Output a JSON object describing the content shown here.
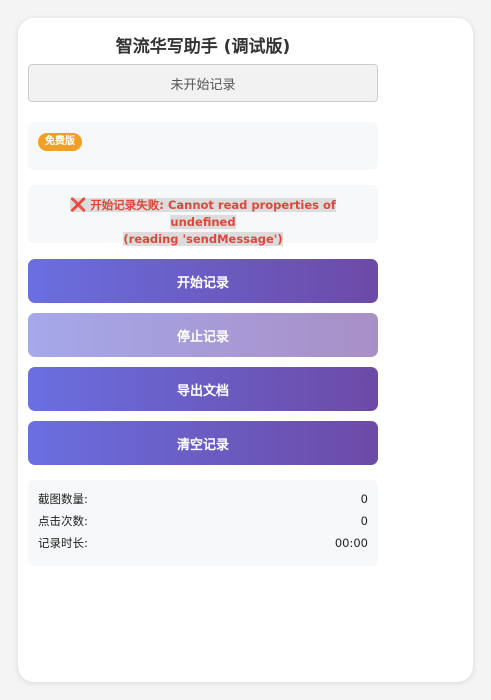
{
  "header": {
    "title": "智流华写助手 (调试版)"
  },
  "status": {
    "text": "未开始记录"
  },
  "license": {
    "badge": "免费版"
  },
  "error": {
    "icon": "cross-icon",
    "prefix": "开始记录失败:",
    "message_line1": "Cannot read properties of undefined",
    "message_line2": "(reading 'sendMessage')"
  },
  "buttons": {
    "start": "开始记录",
    "stop": "停止记录",
    "export": "导出文档",
    "clear": "清空记录"
  },
  "stats": {
    "screenshots": {
      "label": "截图数量:",
      "value": "0"
    },
    "clicks": {
      "label": "点击次数:",
      "value": "0"
    },
    "duration": {
      "label": "记录时长:",
      "value": "00:00"
    }
  },
  "colors": {
    "accent_start": "#6a6fe0",
    "accent_end": "#6c4aa6",
    "badge": "#f0a027",
    "error": "#e0463a"
  }
}
